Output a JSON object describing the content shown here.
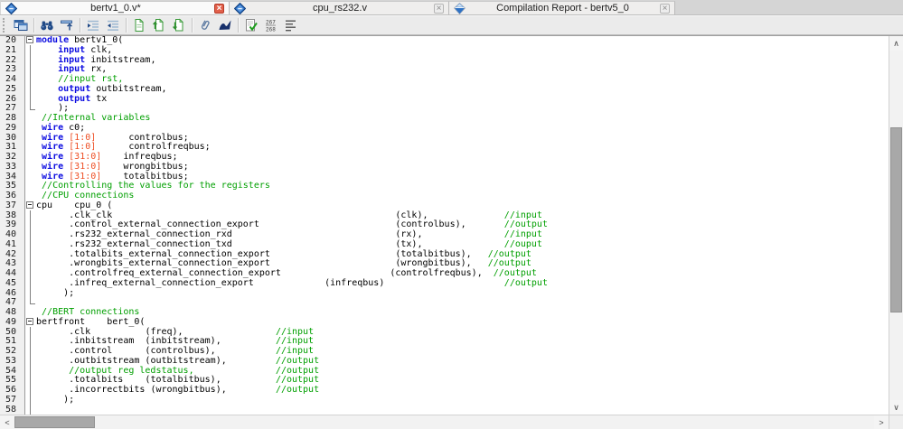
{
  "tabs": [
    {
      "label": "bertv1_0.v*",
      "icon": "hdl-file-icon",
      "close": "red"
    },
    {
      "label": "cpu_rs232.v",
      "icon": "hdl-file-icon",
      "close": "gray"
    },
    {
      "label": "Compilation Report - bertv5_0",
      "icon": "report-icon",
      "close": "gray"
    }
  ],
  "toolbar": {
    "icons": [
      {
        "name": "editor-window-icon"
      },
      {
        "name": "find-icon"
      },
      {
        "name": "goto-line-icon"
      },
      {
        "name": "indent-icon"
      },
      {
        "name": "outdent-icon"
      },
      {
        "name": "insert-bookmark-icon"
      },
      {
        "name": "next-bookmark-icon"
      },
      {
        "name": "previous-bookmark-icon"
      },
      {
        "name": "attach-icon"
      },
      {
        "name": "insert-template-icon"
      },
      {
        "name": "check-syntax-icon"
      },
      {
        "name": "goto-line-number-icon",
        "glyph": "267/268"
      },
      {
        "name": "line-endings-icon"
      }
    ]
  },
  "colors": {
    "keyword": "#0d0de0",
    "comment": "#009f00",
    "number": "#ee4f25",
    "plain": "#000000",
    "gutter_bg": "#f0f0f0",
    "close_red": "#e2604b"
  },
  "editor": {
    "first_visible_line": 20,
    "last_visible_line": 58,
    "lines": [
      {
        "n": 20,
        "fold": "open",
        "segs": [
          {
            "c": "k",
            "t": "module"
          },
          {
            "c": "p",
            "t": " bertv1_0("
          }
        ]
      },
      {
        "n": 21,
        "fold": "line",
        "segs": [
          {
            "c": "p",
            "t": "    "
          },
          {
            "c": "k",
            "t": "input"
          },
          {
            "c": "p",
            "t": " clk,"
          }
        ]
      },
      {
        "n": 22,
        "fold": "line",
        "segs": [
          {
            "c": "p",
            "t": "    "
          },
          {
            "c": "k",
            "t": "input"
          },
          {
            "c": "p",
            "t": " inbitstream,"
          }
        ]
      },
      {
        "n": 23,
        "fold": "line",
        "segs": [
          {
            "c": "p",
            "t": "    "
          },
          {
            "c": "k",
            "t": "input"
          },
          {
            "c": "p",
            "t": " rx,"
          }
        ]
      },
      {
        "n": 24,
        "fold": "line",
        "segs": [
          {
            "c": "p",
            "t": "    "
          },
          {
            "c": "c",
            "t": "//input rst,"
          }
        ]
      },
      {
        "n": 25,
        "fold": "line",
        "segs": [
          {
            "c": "p",
            "t": "    "
          },
          {
            "c": "k",
            "t": "output"
          },
          {
            "c": "p",
            "t": " outbitstream,"
          }
        ]
      },
      {
        "n": 26,
        "fold": "line",
        "segs": [
          {
            "c": "p",
            "t": "    "
          },
          {
            "c": "k",
            "t": "output"
          },
          {
            "c": "p",
            "t": " tx"
          }
        ]
      },
      {
        "n": 27,
        "fold": "end",
        "segs": [
          {
            "c": "p",
            "t": "    );"
          }
        ]
      },
      {
        "n": 28,
        "fold": "none",
        "segs": [
          {
            "c": "p",
            "t": " "
          },
          {
            "c": "c",
            "t": "//Internal variables"
          }
        ]
      },
      {
        "n": 29,
        "fold": "none",
        "segs": [
          {
            "c": "p",
            "t": " "
          },
          {
            "c": "k",
            "t": "wire"
          },
          {
            "c": "p",
            "t": " c0;"
          }
        ]
      },
      {
        "n": 30,
        "fold": "none",
        "segs": [
          {
            "c": "p",
            "t": " "
          },
          {
            "c": "k",
            "t": "wire"
          },
          {
            "c": "p",
            "t": " "
          },
          {
            "c": "n",
            "t": "[1:0]"
          },
          {
            "c": "p",
            "t": "controlbus;",
            "col": 17
          }
        ]
      },
      {
        "n": 31,
        "fold": "none",
        "segs": [
          {
            "c": "p",
            "t": " "
          },
          {
            "c": "k",
            "t": "wire"
          },
          {
            "c": "p",
            "t": " "
          },
          {
            "c": "n",
            "t": "[1:0]"
          },
          {
            "c": "p",
            "t": "controlfreqbus;",
            "col": 17
          }
        ]
      },
      {
        "n": 32,
        "fold": "none",
        "segs": [
          {
            "c": "p",
            "t": " "
          },
          {
            "c": "k",
            "t": "wire"
          },
          {
            "c": "p",
            "t": " "
          },
          {
            "c": "n",
            "t": "[31:0]"
          },
          {
            "c": "p",
            "t": "infreqbus;",
            "col": 16
          }
        ]
      },
      {
        "n": 33,
        "fold": "none",
        "segs": [
          {
            "c": "p",
            "t": " "
          },
          {
            "c": "k",
            "t": "wire"
          },
          {
            "c": "p",
            "t": " "
          },
          {
            "c": "n",
            "t": "[31:0]"
          },
          {
            "c": "p",
            "t": "wrongbitbus;",
            "col": 16
          }
        ]
      },
      {
        "n": 34,
        "fold": "none",
        "segs": [
          {
            "c": "p",
            "t": " "
          },
          {
            "c": "k",
            "t": "wire"
          },
          {
            "c": "p",
            "t": " "
          },
          {
            "c": "n",
            "t": "[31:0]"
          },
          {
            "c": "p",
            "t": "totalbitbus;",
            "col": 16
          }
        ]
      },
      {
        "n": 35,
        "fold": "none",
        "segs": [
          {
            "c": "p",
            "t": " "
          },
          {
            "c": "c",
            "t": "//Controlling the values for the registers"
          }
        ]
      },
      {
        "n": 36,
        "fold": "none",
        "segs": [
          {
            "c": "p",
            "t": " "
          },
          {
            "c": "c",
            "t": "//CPU connections"
          }
        ]
      },
      {
        "n": 37,
        "fold": "open",
        "segs": [
          {
            "c": "p",
            "t": "cpu    cpu_0 ("
          }
        ]
      },
      {
        "n": 38,
        "fold": "line",
        "segs": [
          {
            "c": "p",
            "t": "      .clk_clk"
          },
          {
            "c": "p",
            "t": "(clk),",
            "col": 66
          },
          {
            "c": "c",
            "t": "//input",
            "col": 86
          }
        ]
      },
      {
        "n": 39,
        "fold": "line",
        "segs": [
          {
            "c": "p",
            "t": "      .control_external_connection_export"
          },
          {
            "c": "p",
            "t": "(controlbus),",
            "col": 66
          },
          {
            "c": "c",
            "t": "//output",
            "col": 86
          }
        ]
      },
      {
        "n": 40,
        "fold": "line",
        "segs": [
          {
            "c": "p",
            "t": "      .rs232_external_connection_rxd"
          },
          {
            "c": "p",
            "t": "(rx),",
            "col": 66
          },
          {
            "c": "c",
            "t": "//input",
            "col": 86
          }
        ]
      },
      {
        "n": 41,
        "fold": "line",
        "segs": [
          {
            "c": "p",
            "t": "      .rs232_external_connection_txd"
          },
          {
            "c": "p",
            "t": "(tx),",
            "col": 66
          },
          {
            "c": "c",
            "t": "//ouput",
            "col": 86
          }
        ]
      },
      {
        "n": 42,
        "fold": "line",
        "segs": [
          {
            "c": "p",
            "t": "      .totalbits_external_connection_export"
          },
          {
            "c": "p",
            "t": "(totalbitbus),",
            "col": 66
          },
          {
            "c": "c",
            "t": "//output",
            "col": 83
          }
        ]
      },
      {
        "n": 43,
        "fold": "line",
        "segs": [
          {
            "c": "p",
            "t": "      .wrongbits_external_connection_export"
          },
          {
            "c": "p",
            "t": "(wrongbitbus),",
            "col": 66
          },
          {
            "c": "c",
            "t": "//output",
            "col": 83
          }
        ]
      },
      {
        "n": 44,
        "fold": "line",
        "segs": [
          {
            "c": "p",
            "t": "      .controlfreq_external_connection_export"
          },
          {
            "c": "p",
            "t": "(controlfreqbus),",
            "col": 65
          },
          {
            "c": "c",
            "t": "//output",
            "col": 84
          }
        ]
      },
      {
        "n": 45,
        "fold": "line",
        "segs": [
          {
            "c": "p",
            "t": "      .infreq_external_connection_export"
          },
          {
            "c": "p",
            "t": "(infreqbus)",
            "col": 53
          },
          {
            "c": "c",
            "t": "//output",
            "col": 86
          }
        ]
      },
      {
        "n": 46,
        "fold": "line",
        "segs": [
          {
            "c": "p",
            "t": "     );"
          }
        ]
      },
      {
        "n": 47,
        "fold": "end",
        "segs": []
      },
      {
        "n": 48,
        "fold": "none",
        "segs": [
          {
            "c": "p",
            "t": " "
          },
          {
            "c": "c",
            "t": "//BERT connections"
          }
        ]
      },
      {
        "n": 49,
        "fold": "open",
        "segs": [
          {
            "c": "p",
            "t": "bertfront    bert_0("
          }
        ]
      },
      {
        "n": 50,
        "fold": "line",
        "segs": [
          {
            "c": "p",
            "t": "      .clk"
          },
          {
            "c": "p",
            "t": "(freq),",
            "col": 20
          },
          {
            "c": "c",
            "t": "//input",
            "col": 44
          }
        ]
      },
      {
        "n": 51,
        "fold": "line",
        "segs": [
          {
            "c": "p",
            "t": "      .inbitstream"
          },
          {
            "c": "p",
            "t": "(inbitstream),",
            "col": 20
          },
          {
            "c": "c",
            "t": "//input",
            "col": 44
          }
        ]
      },
      {
        "n": 52,
        "fold": "line",
        "segs": [
          {
            "c": "p",
            "t": "      .control"
          },
          {
            "c": "p",
            "t": "(controlbus),",
            "col": 20
          },
          {
            "c": "c",
            "t": "//input",
            "col": 44
          }
        ]
      },
      {
        "n": 53,
        "fold": "line",
        "segs": [
          {
            "c": "p",
            "t": "      .outbitstream"
          },
          {
            "c": "p",
            "t": "(outbitstream),",
            "col": 20
          },
          {
            "c": "c",
            "t": "//output",
            "col": 44
          }
        ]
      },
      {
        "n": 54,
        "fold": "line",
        "segs": [
          {
            "c": "p",
            "t": "      "
          },
          {
            "c": "c",
            "t": "//output reg ledstatus,"
          },
          {
            "c": "c",
            "t": "//output",
            "col": 44
          }
        ]
      },
      {
        "n": 55,
        "fold": "line",
        "segs": [
          {
            "c": "p",
            "t": "      .totalbits"
          },
          {
            "c": "p",
            "t": "(totalbitbus),",
            "col": 20
          },
          {
            "c": "c",
            "t": "//output",
            "col": 44
          }
        ]
      },
      {
        "n": 56,
        "fold": "line",
        "segs": [
          {
            "c": "p",
            "t": "      .incorrectbits"
          },
          {
            "c": "p",
            "t": "(wrongbitbus),",
            "col": 21
          },
          {
            "c": "c",
            "t": "//output",
            "col": 44
          }
        ]
      },
      {
        "n": 57,
        "fold": "line",
        "segs": [
          {
            "c": "p",
            "t": "     );"
          }
        ]
      },
      {
        "n": 58,
        "fold": "line",
        "segs": []
      }
    ]
  }
}
